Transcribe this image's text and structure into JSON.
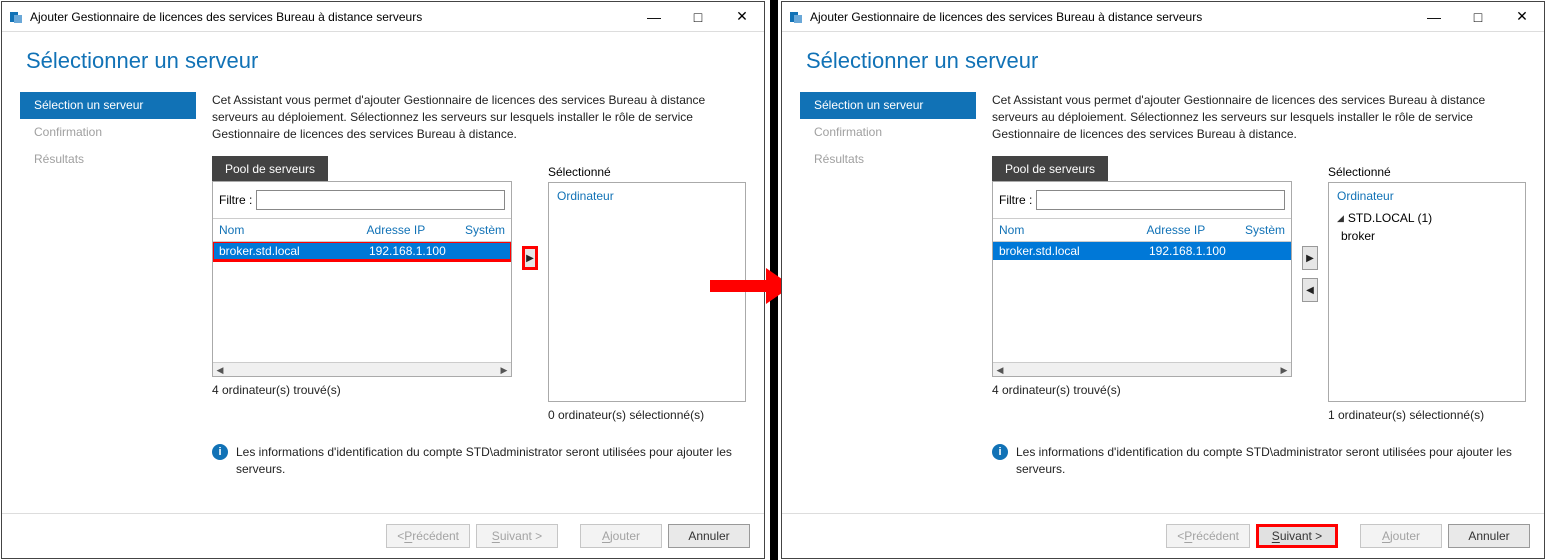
{
  "title_bar": "Ajouter Gestionnaire de licences des services Bureau à distance serveurs",
  "heading": "Sélectionner un serveur",
  "sidebar": {
    "step_select": "Sélection un serveur",
    "step_confirm": "Confirmation",
    "step_results": "Résultats"
  },
  "description": "Cet Assistant vous permet d'ajouter Gestionnaire de licences des services Bureau à distance serveurs au déploiement. Sélectionnez les serveurs sur lesquels installer le rôle de service Gestionnaire de licences des services Bureau à distance.",
  "tab_pool": "Pool de serveurs",
  "filter_label": "Filtre :",
  "col_name": "Nom",
  "col_ip": "Adresse IP",
  "col_sys": "Systèm",
  "sys_col_right": "Systèm",
  "server_row": {
    "name": "broker.std.local",
    "ip": "192.168.1.100"
  },
  "found_left": "4 ordinateur(s) trouvé(s)",
  "found_right": "4 ordinateur(s) trouvé(s)",
  "selected_label": "Sélectionné",
  "selected_head": "Ordinateur",
  "selected_count_left": "0 ordinateur(s) sélectionné(s)",
  "selected_count_right": "1 ordinateur(s) sélectionné(s)",
  "selected_tree_domain": "STD.LOCAL (1)",
  "selected_tree_node": "broker",
  "info_text": "Les informations d'identification du compte STD\\administrator seront utilisées pour ajouter les serveurs.",
  "buttons": {
    "prev_u": "P",
    "prev_rest": "récédent",
    "next_u": "S",
    "next_rest": "uivant >",
    "add_u": "A",
    "add_rest": "jouter",
    "cancel": "Annuler"
  }
}
